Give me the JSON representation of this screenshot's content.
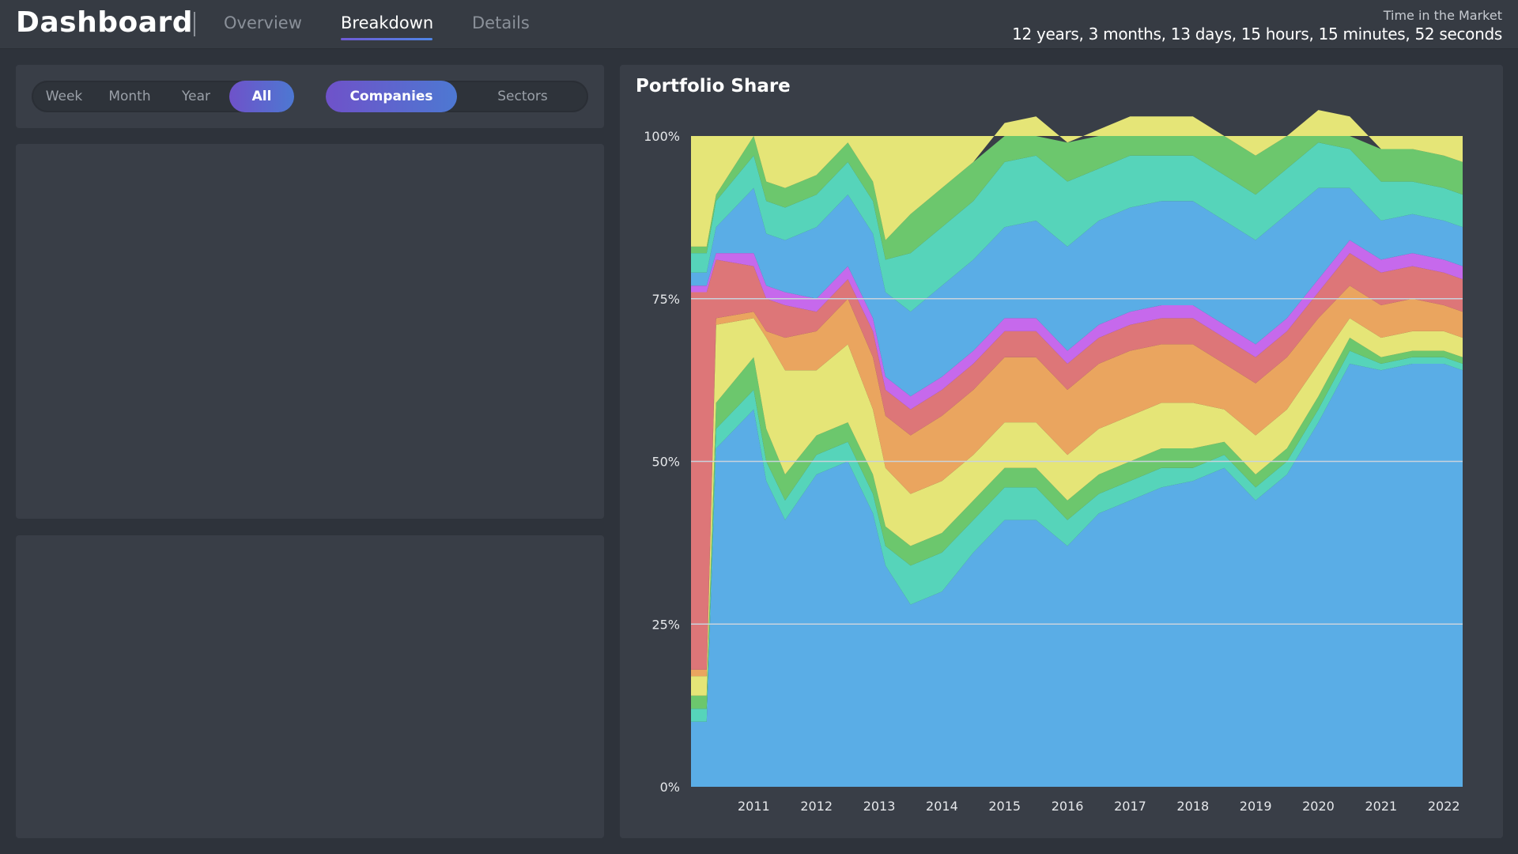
{
  "header": {
    "title": "Dashboard",
    "tabs": [
      {
        "label": "Overview",
        "active": false
      },
      {
        "label": "Breakdown",
        "active": true
      },
      {
        "label": "Details",
        "active": false
      }
    ],
    "time_label": "Time in the Market",
    "time_value": "12 years, 3 months, 13 days, 15 hours, 15 minutes, 52 seconds"
  },
  "controls": {
    "time_ranges": [
      {
        "label": "Week",
        "active": false
      },
      {
        "label": "Month",
        "active": false
      },
      {
        "label": "Year",
        "active": false
      },
      {
        "label": "All",
        "active": true
      }
    ],
    "views": [
      {
        "label": "Companies",
        "active": true
      },
      {
        "label": "Sectors",
        "active": false
      }
    ]
  },
  "colors": {
    "background": "#2e333b",
    "panel": "#393e47",
    "accent_from": "#6f52c9",
    "accent_to": "#4d78d2",
    "gridline": "#c9d3dd"
  },
  "chart_data": {
    "type": "area",
    "title": "Portfolio Share",
    "stacked": true,
    "percent": true,
    "ylim": [
      0,
      100
    ],
    "yticks": [
      "0%",
      "25%",
      "50%",
      "75%",
      "100%"
    ],
    "xticks": [
      "2011",
      "2012",
      "2013",
      "2014",
      "2015",
      "2016",
      "2017",
      "2018",
      "2019",
      "2020",
      "2021",
      "2022"
    ],
    "xlim": [
      2010.0,
      2022.3
    ],
    "grid": "horizontal",
    "x": [
      2010.25,
      2010.4,
      2011.0,
      2011.2,
      2011.5,
      2012.0,
      2012.5,
      2012.9,
      2013.1,
      2013.5,
      2014.0,
      2014.5,
      2015.0,
      2015.5,
      2016.0,
      2016.5,
      2017.0,
      2017.5,
      2018.0,
      2018.5,
      2019.0,
      2019.5,
      2020.0,
      2020.5,
      2021.0,
      2021.5,
      2022.0,
      2022.3
    ],
    "series": [
      {
        "color": "#5aade6",
        "values": [
          10,
          52,
          58,
          47,
          41,
          48,
          50,
          42,
          34,
          28,
          30,
          36,
          41,
          41,
          37,
          42,
          44,
          46,
          47,
          49,
          44,
          48,
          56,
          65,
          64,
          65,
          65,
          64
        ]
      },
      {
        "color": "#56d4ba",
        "values": [
          2,
          3,
          3,
          3,
          3,
          3,
          3,
          3,
          3,
          6,
          6,
          5,
          5,
          5,
          4,
          3,
          3,
          3,
          2,
          2,
          2,
          2,
          2,
          2,
          1,
          1,
          1,
          1
        ]
      },
      {
        "color": "#6cc76d",
        "values": [
          2,
          4,
          5,
          5,
          4,
          3,
          3,
          3,
          3,
          3,
          3,
          3,
          3,
          3,
          3,
          3,
          3,
          3,
          3,
          2,
          2,
          2,
          2,
          2,
          1,
          1,
          1,
          1
        ]
      },
      {
        "color": "#e5e577",
        "values": [
          3,
          12,
          6,
          14,
          16,
          10,
          12,
          10,
          9,
          8,
          8,
          7,
          7,
          7,
          7,
          7,
          7,
          7,
          7,
          5,
          6,
          6,
          5,
          3,
          3,
          3,
          3,
          3
        ]
      },
      {
        "color": "#eaa55f",
        "values": [
          1,
          1,
          1,
          1,
          5,
          6,
          7,
          8,
          8,
          9,
          10,
          10,
          10,
          10,
          10,
          10,
          10,
          9,
          9,
          7,
          8,
          8,
          7,
          5,
          5,
          5,
          4,
          4
        ]
      },
      {
        "color": "#dd7678",
        "values": [
          58,
          9,
          7,
          5,
          5,
          3,
          3,
          4,
          4,
          4,
          4,
          4,
          4,
          4,
          4,
          4,
          4,
          4,
          4,
          4,
          4,
          4,
          4,
          5,
          5,
          5,
          5,
          5
        ]
      },
      {
        "color": "#c669ec",
        "values": [
          1,
          1,
          2,
          2,
          2,
          2,
          2,
          2,
          2,
          2,
          2,
          2,
          2,
          2,
          2,
          2,
          2,
          2,
          2,
          2,
          2,
          2,
          2,
          2,
          2,
          2,
          2,
          2
        ]
      },
      {
        "color": "#5aade6",
        "values": [
          2,
          4,
          10,
          8,
          8,
          11,
          11,
          13,
          13,
          13,
          14,
          14,
          14,
          15,
          16,
          16,
          16,
          16,
          16,
          16,
          16,
          16,
          14,
          8,
          6,
          6,
          6,
          6
        ]
      },
      {
        "color": "#56d4ba",
        "values": [
          3,
          4,
          5,
          5,
          5,
          5,
          5,
          5,
          5,
          9,
          9,
          9,
          10,
          10,
          10,
          8,
          8,
          7,
          7,
          7,
          7,
          7,
          7,
          6,
          6,
          5,
          5,
          5
        ]
      },
      {
        "color": "#6cc76d",
        "values": [
          1,
          1,
          3,
          3,
          3,
          3,
          3,
          3,
          3,
          6,
          6,
          6,
          6,
          6,
          6,
          6,
          6,
          6,
          6,
          6,
          6,
          5,
          5,
          5,
          5,
          5,
          5,
          5
        ]
      },
      {
        "color": "#e5e577",
        "values": [
          17,
          9,
          0,
          7,
          8,
          6,
          1,
          7,
          16,
          12,
          8,
          4,
          -2,
          -3,
          1,
          -1,
          -3,
          -3,
          -3,
          0,
          3,
          0,
          -4,
          -3,
          2,
          2,
          3,
          4
        ]
      }
    ]
  }
}
